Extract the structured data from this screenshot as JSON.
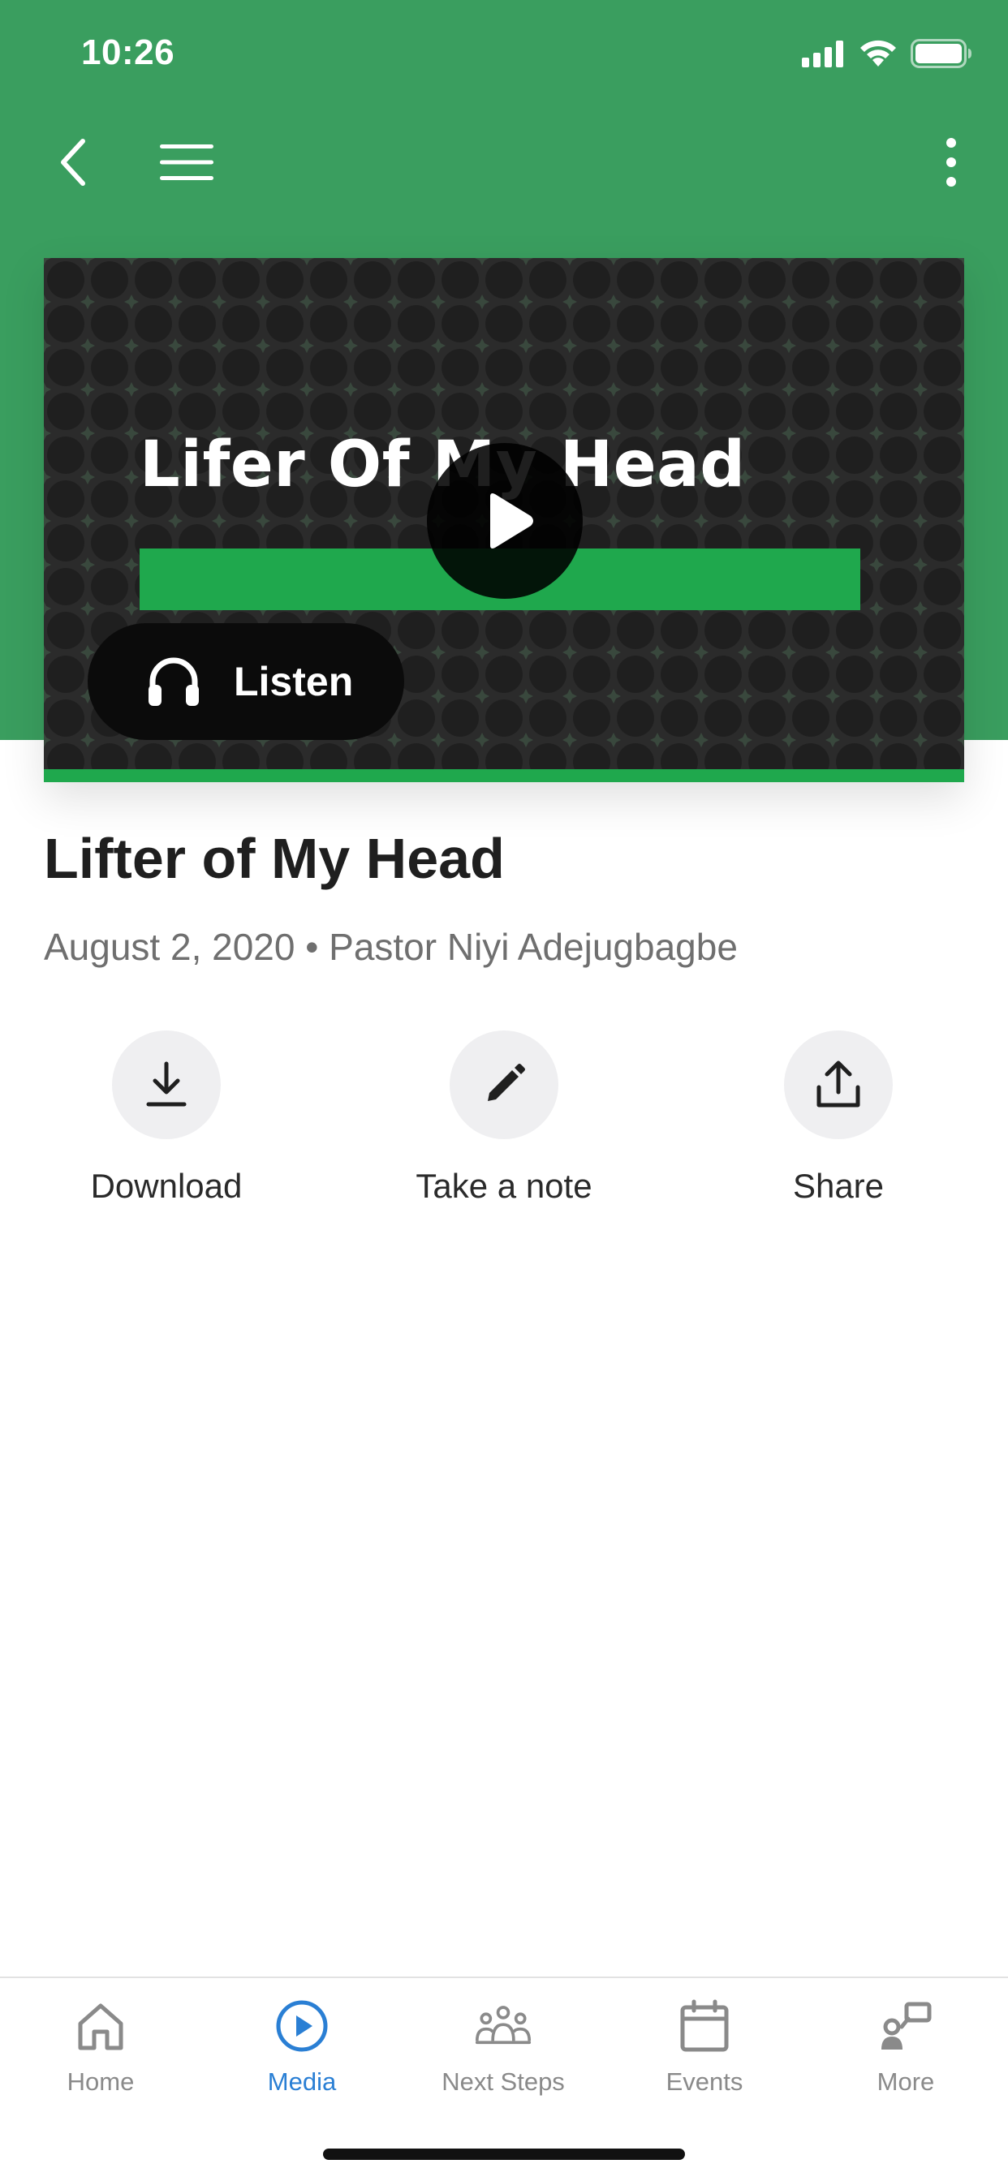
{
  "status_bar": {
    "time": "10:26",
    "icons": [
      "signal-icon",
      "wifi-icon",
      "battery-icon"
    ]
  },
  "nav": {
    "icons": [
      "back-icon",
      "hamburger-menu-icon",
      "more-vertical-icon"
    ]
  },
  "hero": {
    "artwork_title": "Lifer Of My Head",
    "play_icon": "play-icon",
    "listen_label": "Listen",
    "listen_icon": "headphones-icon"
  },
  "sermon": {
    "title": "Lifter of My Head",
    "meta": "August 2, 2020 • Pastor Niyi Adejugbagbe"
  },
  "actions": [
    {
      "label": "Download",
      "icon": "download-icon"
    },
    {
      "label": "Take a note",
      "icon": "pencil-icon"
    },
    {
      "label": "Share",
      "icon": "share-icon"
    }
  ],
  "tabs": [
    {
      "label": "Home",
      "icon": "home-icon",
      "active": false
    },
    {
      "label": "Media",
      "icon": "play-circle-icon",
      "active": true
    },
    {
      "label": "Next Steps",
      "icon": "people-icon",
      "active": false
    },
    {
      "label": "Events",
      "icon": "calendar-icon",
      "active": false
    },
    {
      "label": "More",
      "icon": "more-person-icon",
      "active": false
    }
  ],
  "colors": {
    "header_green": "#3a9e5f",
    "accent_green": "#1fa84d",
    "active_tab_blue": "#2a7fd4",
    "inactive_tab_gray": "#8a8a8a"
  }
}
